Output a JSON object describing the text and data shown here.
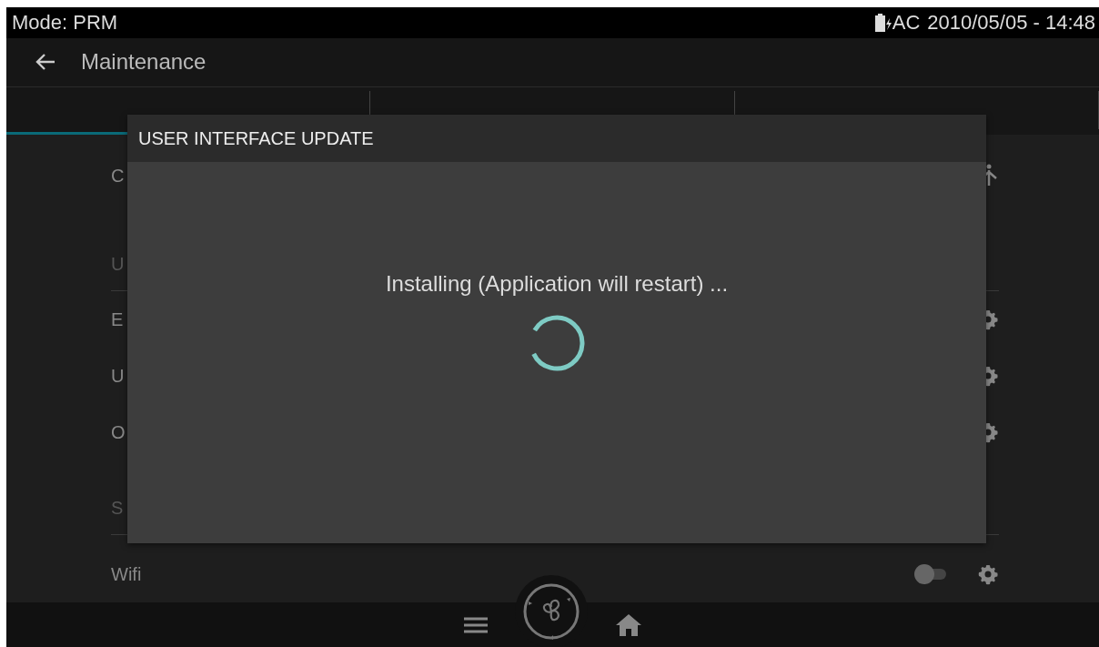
{
  "status_bar": {
    "mode": "Mode: PRM",
    "power": "AC",
    "datetime": "2010/05/05 - 14:48"
  },
  "app_bar": {
    "title": "Maintenance"
  },
  "tabs": [
    {
      "selected": true
    },
    {
      "selected": false
    },
    {
      "selected": false
    }
  ],
  "list": [
    {
      "kind": "action",
      "label": "C"
    },
    {
      "kind": "header",
      "label": "U"
    },
    {
      "kind": "settings",
      "label": "E"
    },
    {
      "kind": "settings",
      "label": "U"
    },
    {
      "kind": "settings",
      "label": "O"
    },
    {
      "kind": "header",
      "label": "S"
    },
    {
      "kind": "toggle",
      "label": "Wifi",
      "on": false
    }
  ],
  "dialog": {
    "title": "USER INTERFACE UPDATE",
    "message": "Installing (Application will restart) ...",
    "busy": true
  }
}
